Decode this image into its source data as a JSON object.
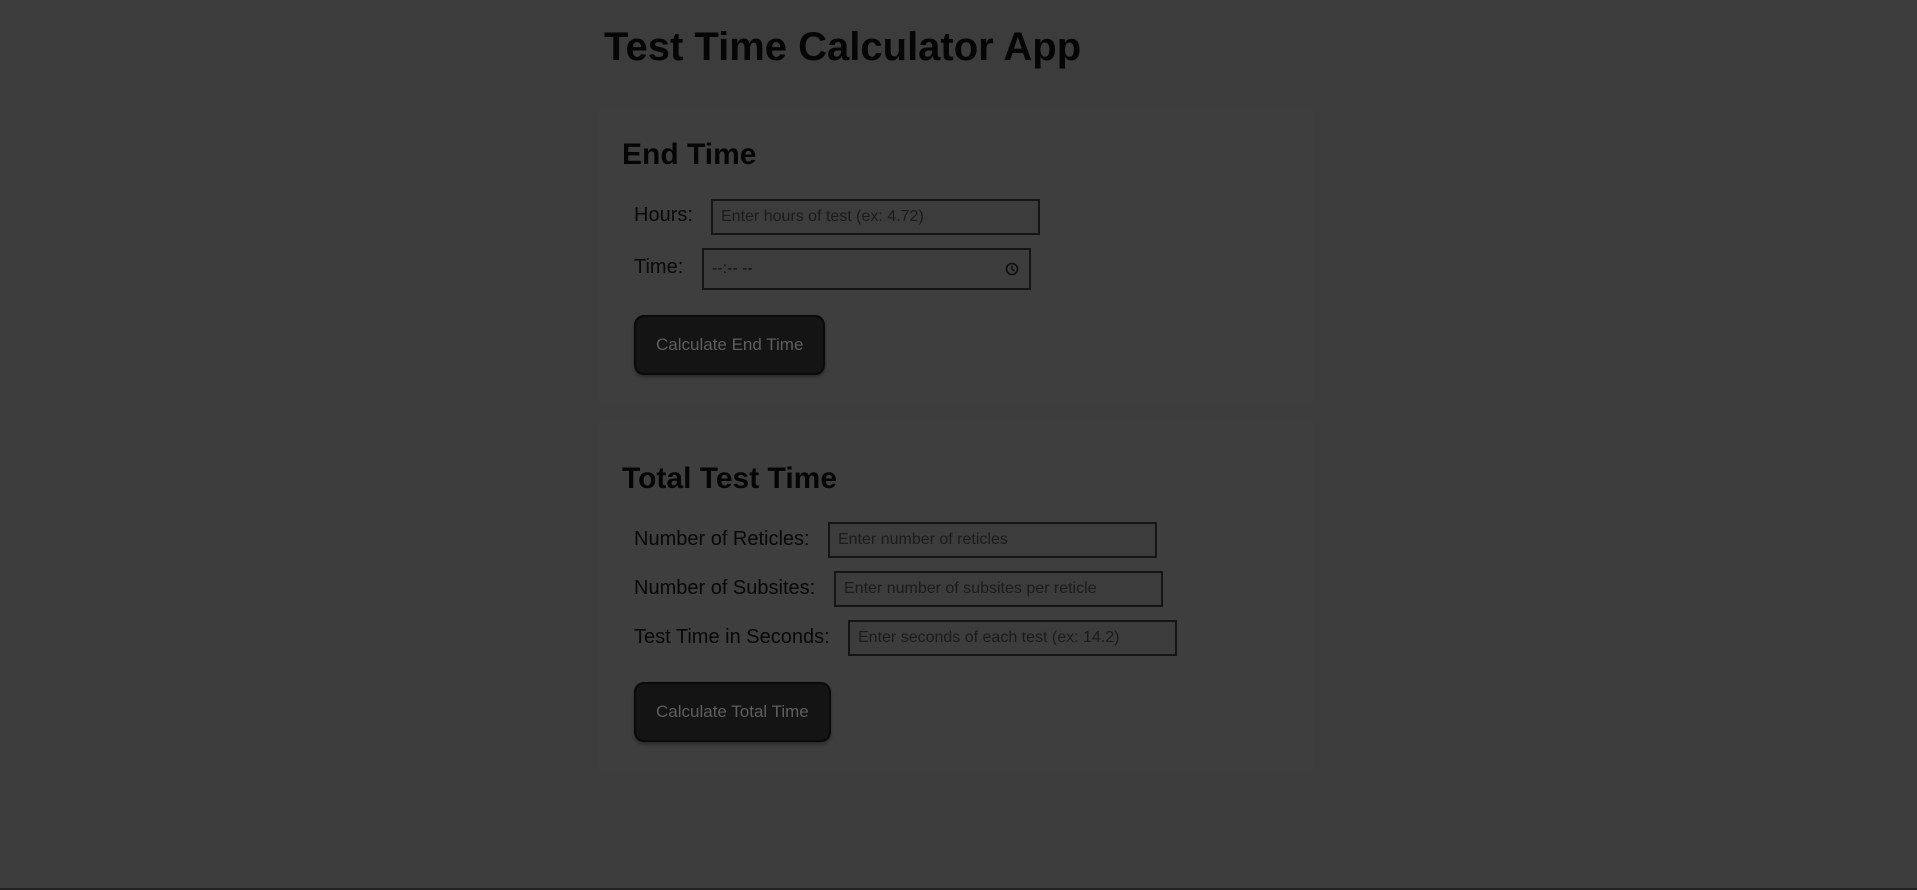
{
  "app": {
    "title": "Test Time Calculator App"
  },
  "end_time": {
    "title": "End Time",
    "hours_label": "Hours:",
    "hours_placeholder": "Enter hours of test (ex: 4.72)",
    "hours_value": "",
    "time_label": "Time:",
    "time_value": "--:-- --",
    "button_label": "Calculate End Time"
  },
  "total_test_time": {
    "title": "Total Test Time",
    "reticles_label": "Number of Reticles:",
    "reticles_placeholder": "Enter number of reticles",
    "subsites_label": "Number of Subsites:",
    "subsites_placeholder": "Enter number of subsites per reticle",
    "seconds_label": "Test Time in Seconds:",
    "seconds_placeholder": "Enter seconds of each test (ex: 14.2)",
    "button_label": "Calculate Total Time"
  },
  "icons": {
    "time_picker": "clock-icon"
  },
  "colors": {
    "background": "#3c3c3c",
    "button_background": "#141414",
    "text": "#050505"
  }
}
